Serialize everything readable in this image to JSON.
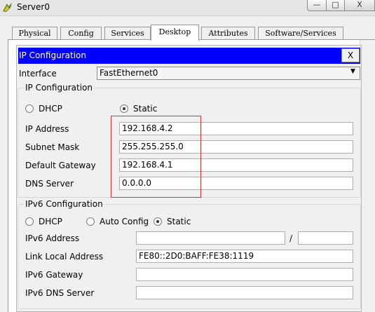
{
  "window": {
    "title": "Server0",
    "minimize": "—",
    "maximize": "□",
    "close": "X"
  },
  "tabs": [
    {
      "label": "Physical"
    },
    {
      "label": "Config"
    },
    {
      "label": "Services"
    },
    {
      "label": "Desktop",
      "active": true
    },
    {
      "label": "Attributes"
    },
    {
      "label": "Software/Services"
    }
  ],
  "dialog": {
    "title": "IP Configuration",
    "close_label": "X",
    "header_color": "#0000ff",
    "interface_label": "Interface",
    "interface_value": "FastEthernet0",
    "ipv4": {
      "legend": "IP Configuration",
      "dhcp_label": "DHCP",
      "static_label": "Static",
      "selected_mode": "Static",
      "ip_label": "IP Address",
      "ip_value": "192.168.4.2",
      "mask_label": "Subnet Mask",
      "mask_value": "255.255.255.0",
      "gateway_label": "Default Gateway",
      "gateway_value": "192.168.4.1",
      "dns_label": "DNS Server",
      "dns_value": "0.0.0.0"
    },
    "ipv6": {
      "legend": "IPv6 Configuration",
      "dhcp_label": "DHCP",
      "auto_label": "Auto Config",
      "static_label": "Static",
      "selected_mode": "Static",
      "address_label": "IPv6 Address",
      "address_value": "",
      "prefix_separator": "/",
      "prefix_value": "",
      "link_local_label": "Link Local Address",
      "link_local_value": "FE80::2D0:BAFF:FE38:1119",
      "gateway_label": "IPv6 Gateway",
      "gateway_value": "",
      "dns_label": "IPv6 DNS Server",
      "dns_value": ""
    }
  },
  "colors": {
    "highlight_box": "#e03030",
    "active_tab": "#ffffff"
  }
}
